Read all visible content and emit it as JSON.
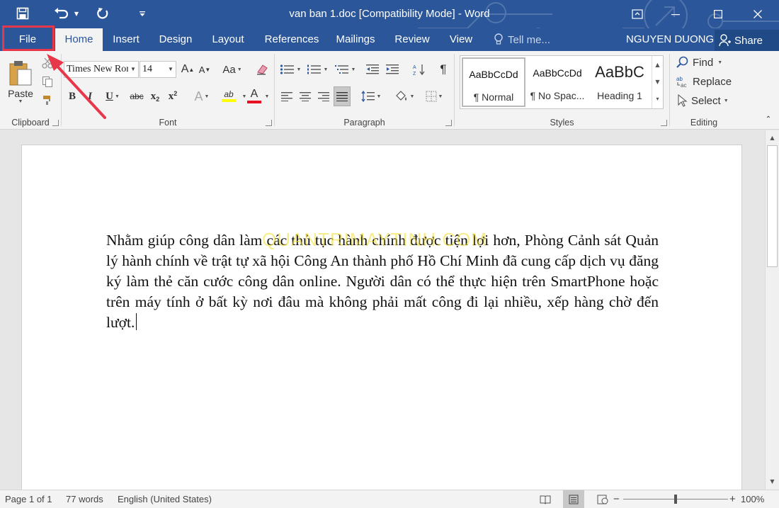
{
  "window": {
    "title": "van ban 1.doc [Compatibility Mode] - Word"
  },
  "qat": {
    "save_icon": "save-icon",
    "undo_icon": "undo-icon",
    "redo_icon": "redo-icon",
    "customize_icon": "customize-qat-icon"
  },
  "tabs": {
    "file": "File",
    "home": "Home",
    "insert": "Insert",
    "design": "Design",
    "layout": "Layout",
    "references": "References",
    "mailings": "Mailings",
    "review": "Review",
    "view": "View",
    "tell_me_placeholder": "Tell me...",
    "user_name": "NGUYEN DUONG",
    "share": "Share"
  },
  "ribbon": {
    "clipboard": {
      "label": "Clipboard",
      "paste": "Paste"
    },
    "font": {
      "label": "Font",
      "family": "Times New Roman",
      "size": "14",
      "bold": "B",
      "italic": "I",
      "underline": "U",
      "strikethrough": "abc",
      "subscript": "x",
      "superscript": "x",
      "text_effects": "A",
      "highlight": "ab",
      "font_color": "A",
      "grow": "A",
      "shrink": "A",
      "change_case": "Aa",
      "highlight_color": "#ffff00",
      "font_color_value": "#e81123"
    },
    "paragraph": {
      "label": "Paragraph"
    },
    "styles": {
      "label": "Styles",
      "items": [
        {
          "sample": "AaBbCcDd",
          "name": "¶ Normal"
        },
        {
          "sample": "AaBbCcDd",
          "name": "¶ No Spac..."
        },
        {
          "sample": "AaBbC",
          "name": "Heading 1"
        }
      ]
    },
    "editing": {
      "label": "Editing",
      "find": "Find",
      "replace": "Replace",
      "select": "Select"
    }
  },
  "document": {
    "body": "Nhằm giúp công dân làm các thủ tục hành chính được tiện lợi hơn, Phòng Cảnh sát Quản lý hành chính về trật tự xã hội Công An thành phố Hồ Chí Minh đã cung cấp dịch vụ đăng ký làm thẻ căn cước công dân online. Người dân có thể thực hiện trên SmartPhone hoặc trên máy tính ở bất kỳ nơi đâu mà không phải mất công đi lại nhiều, xếp hàng chờ đến lượt.",
    "watermark": "QUANTRIMAYTINH.COM"
  },
  "status": {
    "page": "Page 1 of 1",
    "words": "77 words",
    "language": "English (United States)",
    "zoom": "100%",
    "zoom_level": 1.0
  },
  "colors": {
    "brand": "#2b579a",
    "annotation": "#e8364b"
  }
}
